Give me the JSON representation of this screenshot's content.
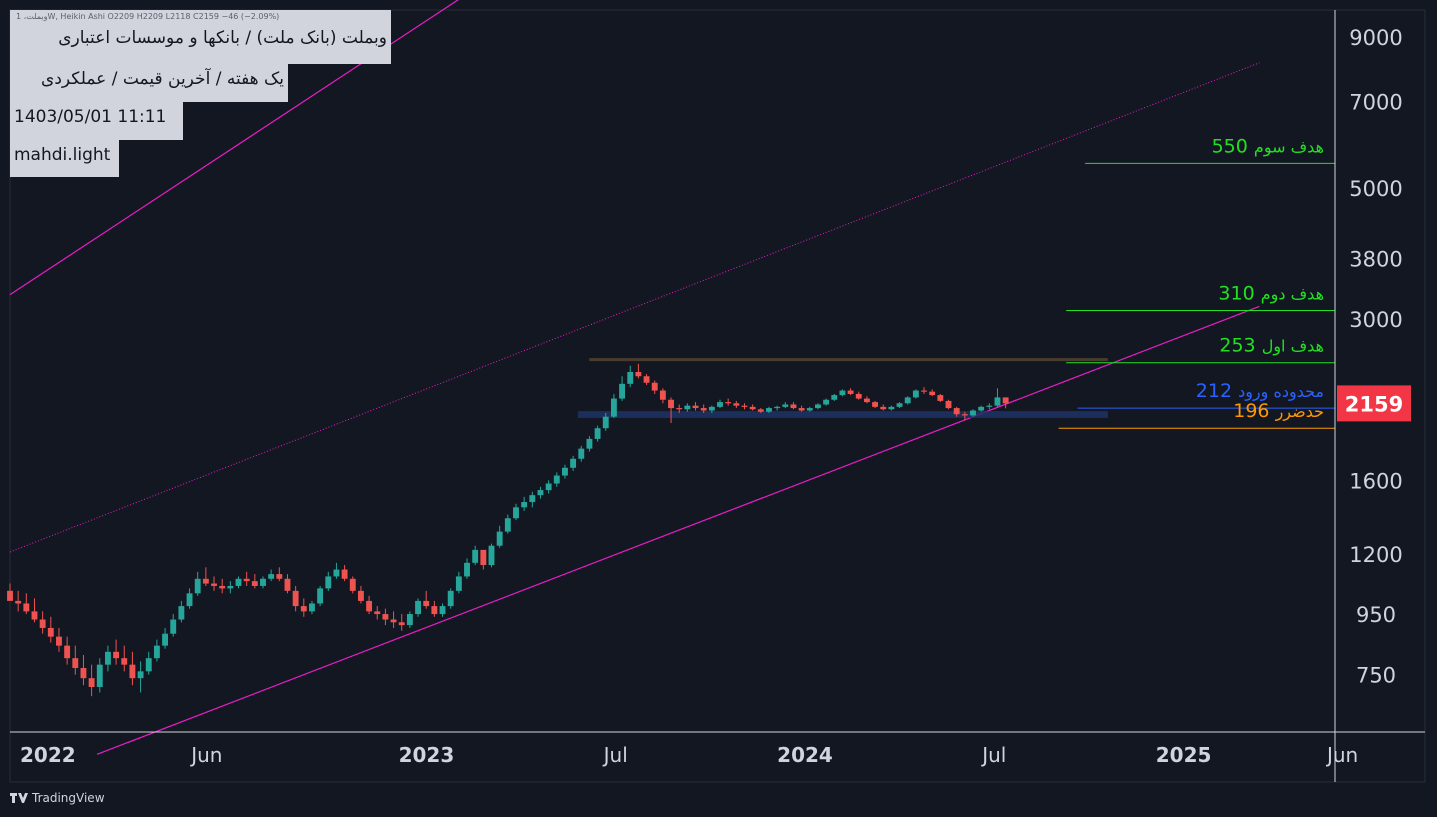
{
  "header": {
    "ohlc_line": "وبملت، 1W, Heikin Ashi  O2209  H2209  L2118  C2159  −46 (−2.09%)",
    "title": "وبملت (بانک ملت) / بانکها و موسسات اعتباری",
    "subtitle": "یک هفته / آخرین قیمت / عملکردی",
    "datetime": "1403/05/01 11:11",
    "author": "mahdi.light"
  },
  "footer": {
    "brand": "TradingView"
  },
  "colors": {
    "background": "#131722",
    "up": "#26a69a",
    "down": "#ef5350",
    "channel": "#e91ec8",
    "target": "#22e022",
    "entry": "#2962ff",
    "stop": "#ff9800",
    "price_badge": "#f23645"
  },
  "chart_data": {
    "type": "candlestick",
    "subtype": "heikin-ashi",
    "timeframe": "1W",
    "y_scale": "log",
    "ylim": [
      600,
      10000
    ],
    "xlim": [
      2021.9,
      2025.4
    ],
    "y_ticks": [
      9000,
      7000,
      5000,
      3800,
      3000,
      1600,
      1200,
      950,
      750
    ],
    "x_ticks": [
      {
        "label": "2022",
        "x": 2022.0,
        "bold": true
      },
      {
        "label": "Jun",
        "x": 2022.42,
        "bold": false
      },
      {
        "label": "2023",
        "x": 2023.0,
        "bold": true
      },
      {
        "label": "Jul",
        "x": 2023.5,
        "bold": false
      },
      {
        "label": "2024",
        "x": 2024.0,
        "bold": true
      },
      {
        "label": "Jul",
        "x": 2024.5,
        "bold": false
      },
      {
        "label": "2025",
        "x": 2025.0,
        "bold": true
      },
      {
        "label": "Jun",
        "x": 2025.42,
        "bold": false
      }
    ],
    "last_price": 2159,
    "levels": [
      {
        "name": "هدف سوم",
        "value": "550",
        "price": 5500,
        "color": "#22e022",
        "x_start": 2024.74
      },
      {
        "name": "هدف دوم",
        "value": "310",
        "price": 3100,
        "color": "#22e022",
        "x_start": 2024.69
      },
      {
        "name": "هدف اول",
        "value": "253",
        "price": 2530,
        "color": "#22e022",
        "x_start": 2024.69
      },
      {
        "name": "محدوده ورود",
        "value": "212",
        "price": 2120,
        "color": "#2962ff",
        "x_start": 2024.72
      },
      {
        "name": "حدضرر",
        "value": "196",
        "price": 1960,
        "color": "#ff9800",
        "x_start": 2024.67
      }
    ],
    "channel": [
      {
        "style": "solid",
        "points": [
          [
            2021.9,
            3298
          ],
          [
            2023.1,
            10570
          ]
        ]
      },
      {
        "style": "dotted",
        "points": [
          [
            2021.9,
            1210
          ],
          [
            2025.2,
            8140
          ]
        ]
      },
      {
        "style": "solid",
        "points": [
          [
            2022.13,
            550
          ],
          [
            2025.2,
            3150
          ]
        ]
      }
    ],
    "resistance_line": {
      "price": 2560,
      "x": [
        2023.43,
        2024.8
      ]
    },
    "support_zone": {
      "price_top": 2095,
      "price_bottom": 2040,
      "x": [
        2023.4,
        2024.8
      ]
    },
    "candles": [
      [
        1040,
        1070,
        1010,
        1000
      ],
      [
        1000,
        1040,
        960,
        990
      ],
      [
        990,
        1030,
        950,
        960
      ],
      [
        960,
        1010,
        920,
        930
      ],
      [
        930,
        960,
        880,
        900
      ],
      [
        900,
        940,
        850,
        870
      ],
      [
        870,
        900,
        820,
        840
      ],
      [
        840,
        870,
        780,
        800
      ],
      [
        800,
        840,
        750,
        770
      ],
      [
        770,
        810,
        720,
        740
      ],
      [
        740,
        780,
        690,
        715
      ],
      [
        715,
        800,
        700,
        780
      ],
      [
        780,
        840,
        760,
        820
      ],
      [
        820,
        860,
        780,
        800
      ],
      [
        800,
        840,
        760,
        780
      ],
      [
        780,
        820,
        720,
        740
      ],
      [
        740,
        790,
        700,
        760
      ],
      [
        760,
        820,
        750,
        800
      ],
      [
        800,
        860,
        790,
        840
      ],
      [
        840,
        900,
        830,
        880
      ],
      [
        880,
        950,
        870,
        930
      ],
      [
        930,
        1000,
        920,
        980
      ],
      [
        980,
        1050,
        970,
        1030
      ],
      [
        1030,
        1120,
        1020,
        1090
      ],
      [
        1090,
        1140,
        1060,
        1070
      ],
      [
        1070,
        1100,
        1040,
        1060
      ],
      [
        1060,
        1090,
        1030,
        1050
      ],
      [
        1050,
        1080,
        1030,
        1060
      ],
      [
        1060,
        1100,
        1050,
        1090
      ],
      [
        1090,
        1120,
        1060,
        1080
      ],
      [
        1080,
        1110,
        1050,
        1060
      ],
      [
        1060,
        1100,
        1050,
        1090
      ],
      [
        1090,
        1130,
        1080,
        1110
      ],
      [
        1110,
        1140,
        1080,
        1090
      ],
      [
        1090,
        1110,
        1030,
        1040
      ],
      [
        1040,
        1060,
        960,
        980
      ],
      [
        980,
        1010,
        940,
        960
      ],
      [
        960,
        1000,
        950,
        990
      ],
      [
        990,
        1060,
        980,
        1050
      ],
      [
        1050,
        1120,
        1040,
        1100
      ],
      [
        1100,
        1160,
        1090,
        1130
      ],
      [
        1130,
        1150,
        1080,
        1090
      ],
      [
        1090,
        1100,
        1030,
        1040
      ],
      [
        1040,
        1060,
        990,
        1000
      ],
      [
        1000,
        1020,
        950,
        960
      ],
      [
        960,
        980,
        930,
        950
      ],
      [
        950,
        970,
        910,
        930
      ],
      [
        930,
        960,
        900,
        920
      ],
      [
        920,
        950,
        890,
        910
      ],
      [
        910,
        960,
        900,
        950
      ],
      [
        950,
        1010,
        940,
        1000
      ],
      [
        1000,
        1040,
        970,
        980
      ],
      [
        980,
        1000,
        940,
        950
      ],
      [
        950,
        990,
        940,
        980
      ],
      [
        980,
        1050,
        970,
        1040
      ],
      [
        1040,
        1120,
        1030,
        1100
      ],
      [
        1100,
        1180,
        1090,
        1160
      ],
      [
        1160,
        1240,
        1150,
        1220
      ],
      [
        1220,
        1200,
        1130,
        1150
      ],
      [
        1150,
        1250,
        1140,
        1240
      ],
      [
        1240,
        1340,
        1230,
        1310
      ],
      [
        1310,
        1400,
        1300,
        1380
      ],
      [
        1380,
        1460,
        1370,
        1440
      ],
      [
        1440,
        1500,
        1420,
        1470
      ],
      [
        1470,
        1530,
        1440,
        1510
      ],
      [
        1510,
        1560,
        1490,
        1540
      ],
      [
        1540,
        1600,
        1520,
        1580
      ],
      [
        1580,
        1650,
        1560,
        1630
      ],
      [
        1630,
        1700,
        1610,
        1680
      ],
      [
        1680,
        1760,
        1660,
        1740
      ],
      [
        1740,
        1830,
        1720,
        1810
      ],
      [
        1810,
        1900,
        1790,
        1880
      ],
      [
        1880,
        1980,
        1860,
        1960
      ],
      [
        1960,
        2080,
        1940,
        2050
      ],
      [
        2050,
        2240,
        2040,
        2200
      ],
      [
        2200,
        2400,
        2180,
        2330
      ],
      [
        2330,
        2500,
        2300,
        2440
      ],
      [
        2440,
        2520,
        2380,
        2400
      ],
      [
        2400,
        2420,
        2320,
        2340
      ],
      [
        2340,
        2360,
        2240,
        2270
      ],
      [
        2270,
        2290,
        2160,
        2190
      ],
      [
        2190,
        2210,
        2000,
        2120
      ],
      [
        2120,
        2150,
        2080,
        2110
      ],
      [
        2110,
        2160,
        2090,
        2140
      ],
      [
        2140,
        2170,
        2100,
        2120
      ],
      [
        2120,
        2150,
        2080,
        2100
      ],
      [
        2100,
        2140,
        2080,
        2130
      ],
      [
        2130,
        2190,
        2120,
        2170
      ],
      [
        2170,
        2200,
        2140,
        2160
      ],
      [
        2160,
        2180,
        2120,
        2140
      ],
      [
        2140,
        2160,
        2110,
        2130
      ],
      [
        2130,
        2150,
        2100,
        2110
      ],
      [
        2110,
        2120,
        2080,
        2090
      ],
      [
        2090,
        2130,
        2080,
        2120
      ],
      [
        2120,
        2140,
        2100,
        2130
      ],
      [
        2130,
        2170,
        2120,
        2150
      ],
      [
        2150,
        2170,
        2110,
        2120
      ],
      [
        2120,
        2140,
        2090,
        2100
      ],
      [
        2100,
        2130,
        2090,
        2120
      ],
      [
        2120,
        2160,
        2110,
        2150
      ],
      [
        2150,
        2200,
        2140,
        2190
      ],
      [
        2190,
        2240,
        2180,
        2230
      ],
      [
        2230,
        2280,
        2220,
        2270
      ],
      [
        2270,
        2290,
        2230,
        2240
      ],
      [
        2240,
        2260,
        2190,
        2200
      ],
      [
        2200,
        2220,
        2160,
        2170
      ],
      [
        2170,
        2180,
        2120,
        2130
      ],
      [
        2130,
        2150,
        2100,
        2110
      ],
      [
        2110,
        2140,
        2100,
        2130
      ],
      [
        2130,
        2170,
        2120,
        2160
      ],
      [
        2160,
        2220,
        2150,
        2210
      ],
      [
        2210,
        2280,
        2200,
        2270
      ],
      [
        2270,
        2300,
        2240,
        2260
      ],
      [
        2260,
        2280,
        2220,
        2230
      ],
      [
        2230,
        2240,
        2170,
        2180
      ],
      [
        2180,
        2190,
        2110,
        2120
      ],
      [
        2120,
        2130,
        2050,
        2070
      ],
      [
        2070,
        2090,
        2020,
        2060
      ],
      [
        2060,
        2110,
        2050,
        2100
      ],
      [
        2100,
        2140,
        2090,
        2130
      ],
      [
        2130,
        2160,
        2110,
        2140
      ],
      [
        2140,
        2290,
        2130,
        2210
      ],
      [
        2210,
        2209,
        2118,
        2159
      ]
    ]
  }
}
